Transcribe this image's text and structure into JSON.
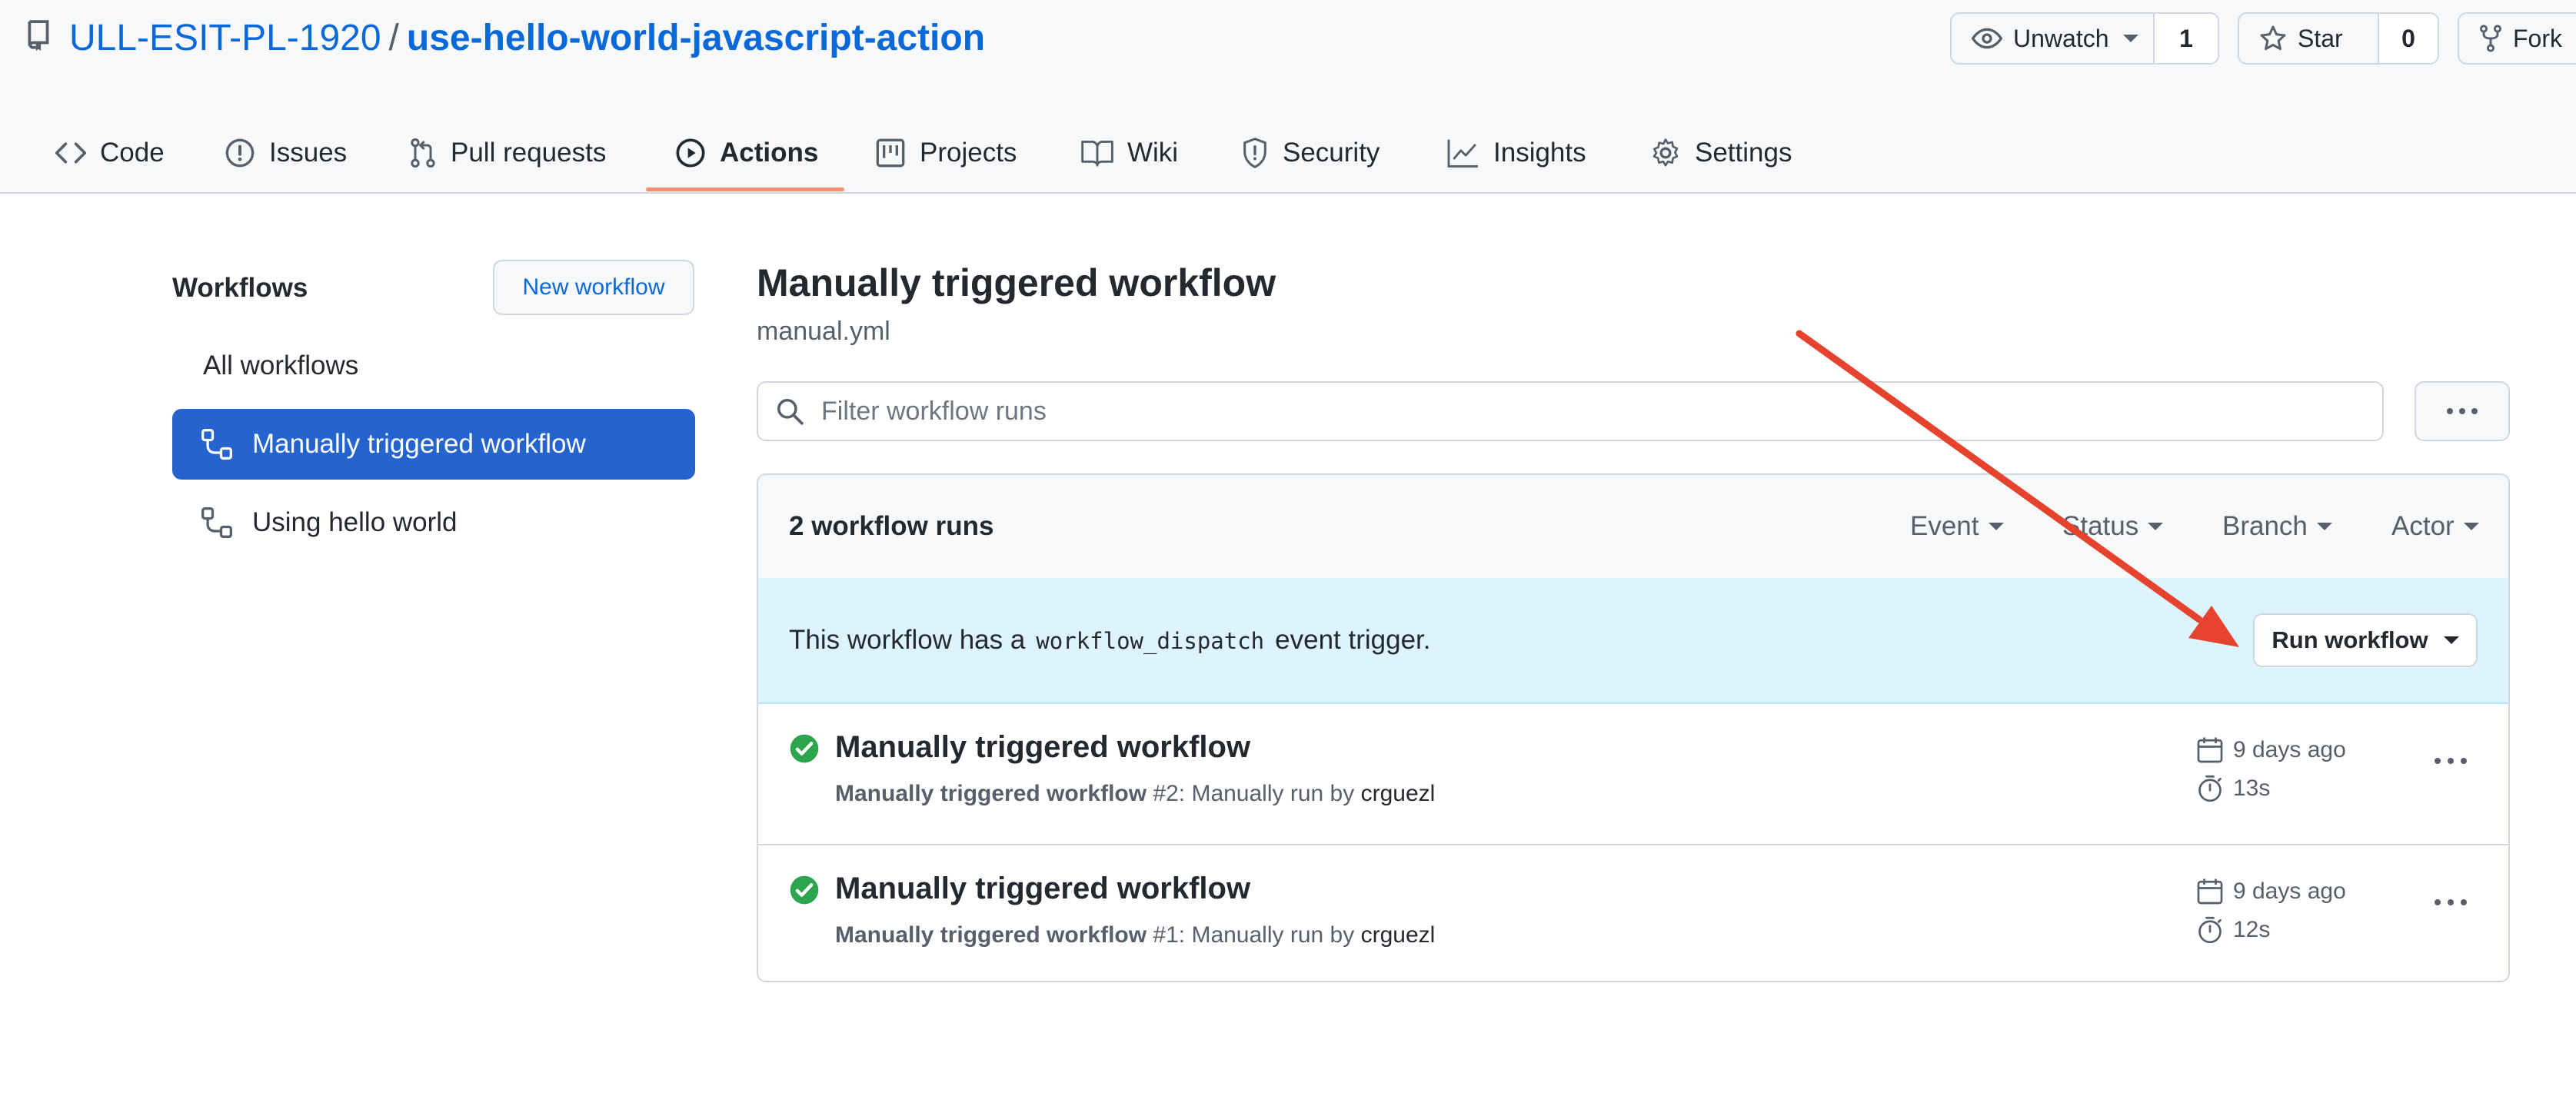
{
  "repo": {
    "owner": "ULL-ESIT-PL-1920",
    "separator": "/",
    "name": "use-hello-world-javascript-action"
  },
  "header_buttons": {
    "watch_label": "Unwatch",
    "watch_count": "1",
    "star_label": "Star",
    "star_count": "0",
    "fork_label": "Fork"
  },
  "tabs": [
    {
      "label": "Code",
      "icon": "code-icon"
    },
    {
      "label": "Issues",
      "icon": "issue-icon"
    },
    {
      "label": "Pull requests",
      "icon": "pull-request-icon"
    },
    {
      "label": "Actions",
      "icon": "play-icon",
      "active": true
    },
    {
      "label": "Projects",
      "icon": "project-icon"
    },
    {
      "label": "Wiki",
      "icon": "book-icon"
    },
    {
      "label": "Security",
      "icon": "shield-icon"
    },
    {
      "label": "Insights",
      "icon": "graph-icon"
    },
    {
      "label": "Settings",
      "icon": "gear-icon"
    }
  ],
  "sidebar": {
    "title": "Workflows",
    "new_workflow_label": "New workflow",
    "items": [
      {
        "label": "All workflows"
      },
      {
        "label": "Manually triggered workflow",
        "active": true,
        "icon": "workflow-icon"
      },
      {
        "label": "Using hello world",
        "icon": "workflow-icon"
      }
    ]
  },
  "main": {
    "title": "Manually triggered workflow",
    "file": "manual.yml",
    "filter_placeholder": "Filter workflow runs",
    "runs_count": "2 workflow runs",
    "filters": [
      "Event",
      "Status",
      "Branch",
      "Actor"
    ],
    "dispatch_prefix": "This workflow has a",
    "dispatch_code": "workflow_dispatch",
    "dispatch_suffix": "event trigger.",
    "run_workflow_label": "Run workflow",
    "runs": [
      {
        "title": "Manually triggered workflow",
        "workflow": "Manually triggered workflow",
        "number": "#2",
        "desc": ": Manually run by",
        "actor": "crguezl",
        "date": "9 days ago",
        "duration": "13s",
        "status": "success"
      },
      {
        "title": "Manually triggered workflow",
        "workflow": "Manually triggered workflow",
        "number": "#1",
        "desc": ": Manually run by",
        "actor": "crguezl",
        "date": "9 days ago",
        "duration": "12s",
        "status": "success"
      }
    ]
  },
  "colors": {
    "link": "#0969da",
    "active_sidebar": "#2563cf",
    "tab_underline": "#fd8c73",
    "dispatch_bg": "#ddf4ff",
    "success": "#2da44e",
    "annotation_arrow": "#e5432d"
  }
}
